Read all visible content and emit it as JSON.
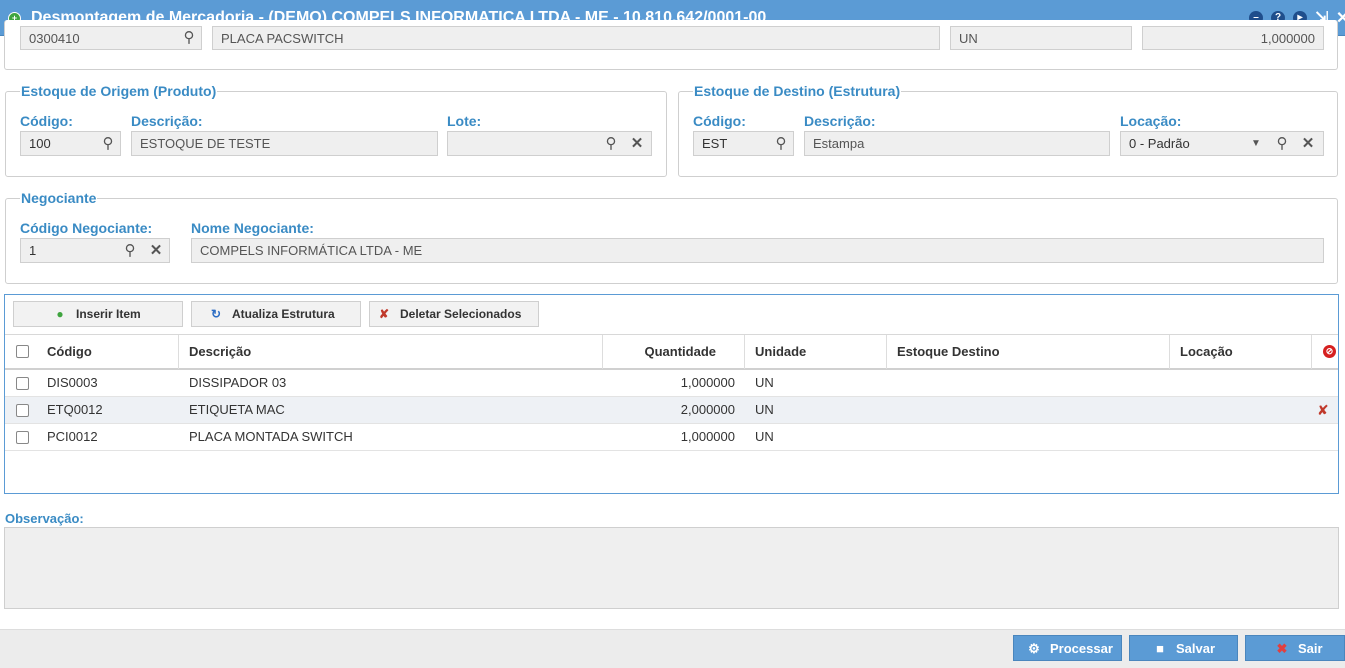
{
  "window": {
    "title": "Desmontagem de Mercadoria - (DEMO) COMPELS INFORMATICA LTDA - ME - 10.810.642/0001-00"
  },
  "product_row": {
    "code": "0300410",
    "description": "PLACA PACSWITCH",
    "unit": "UN",
    "quantity": "1,000000"
  },
  "origin": {
    "legend": "Estoque de Origem (Produto)",
    "code_label": "Código:",
    "code_value": "100",
    "desc_label": "Descrição:",
    "desc_value": "ESTOQUE DE TESTE",
    "lote_label": "Lote:",
    "lote_value": ""
  },
  "destination": {
    "legend": "Estoque de Destino (Estrutura)",
    "code_label": "Código:",
    "code_value": "EST",
    "desc_label": "Descrição:",
    "desc_value": "Estampa",
    "loc_label": "Locação:",
    "loc_value": "0 - Padrão"
  },
  "negociante": {
    "legend": "Negociante",
    "code_label": "Código Negociante:",
    "code_value": "1",
    "name_label": "Nome Negociante:",
    "name_value": "COMPELS INFORMÁTICA LTDA - ME"
  },
  "toolbar": {
    "insert_label": "Inserir Item",
    "update_label": "Atualiza Estrutura",
    "delete_label": "Deletar Selecionados"
  },
  "grid": {
    "columns": {
      "code": "Código",
      "description": "Descrição",
      "quantity": "Quantidade",
      "unit": "Unidade",
      "stock": "Estoque Destino",
      "location": "Locação"
    },
    "rows": [
      {
        "code": "DIS0003",
        "description": "DISSIPADOR 03",
        "quantity": "1,000000",
        "unit": "UN",
        "stock": "",
        "location": ""
      },
      {
        "code": "ETQ0012",
        "description": "ETIQUETA MAC",
        "quantity": "2,000000",
        "unit": "UN",
        "stock": "",
        "location": ""
      },
      {
        "code": "PCI0012",
        "description": "PLACA MONTADA SWITCH",
        "quantity": "1,000000",
        "unit": "UN",
        "stock": "",
        "location": ""
      }
    ]
  },
  "observation": {
    "label": "Observação:",
    "value": ""
  },
  "footer": {
    "process_label": "Processar",
    "save_label": "Salvar",
    "exit_label": "Sair"
  },
  "colors": {
    "accent": "#5b9bd5",
    "label": "#3a8bc4",
    "header_bg": "#5b9bd5"
  }
}
